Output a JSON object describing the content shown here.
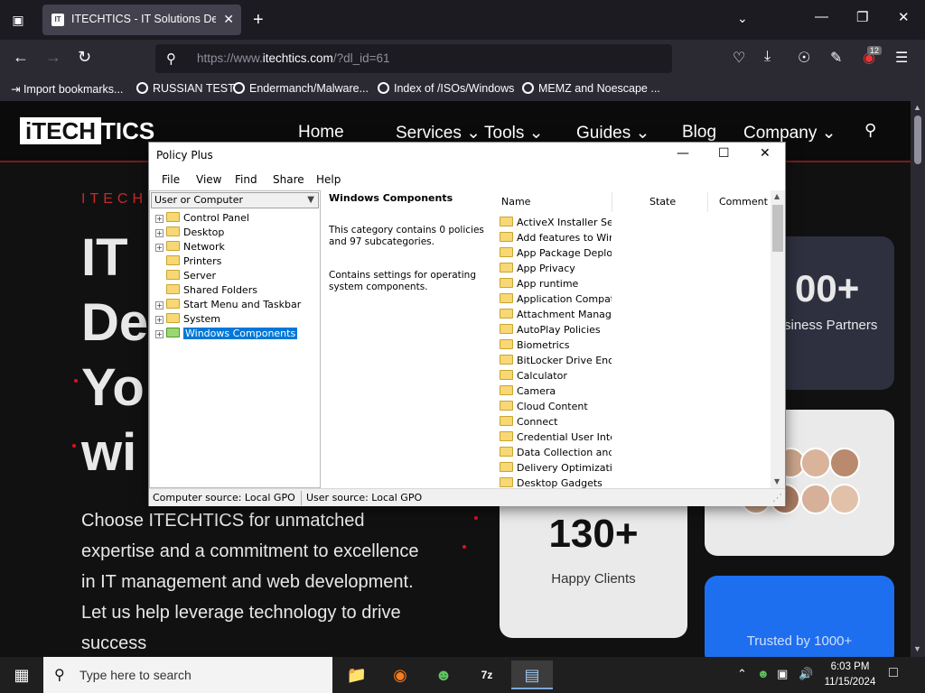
{
  "browser": {
    "tab_title": "ITECHTICS - IT Solutions Design",
    "url_prefix": "https://www.",
    "url_domain": "itechtics.com",
    "url_suffix": "/?dl_id=61",
    "extension_badge": "12",
    "bookmarks": [
      "Import bookmarks...",
      "RUSSIAN TEST",
      "Endermanch/Malware...",
      "Index of /ISOs/Windows",
      "MEMZ and Noescape ..."
    ]
  },
  "site": {
    "logo_box": "iTECH",
    "logo_rest": "TICS",
    "nav": [
      "Home",
      "Services",
      "Tools",
      "Guides",
      "Blog",
      "Company"
    ],
    "kicker": "ITECHT",
    "hero_lines": [
      "IT",
      "De",
      "Yo",
      "wi"
    ],
    "hero_sub": "Choose ITECHTICS for unmatched expertise and a commitment to excellence in IT management and web development. Let us help leverage technology to drive success",
    "partners_num": "00+",
    "partners_label": "siness Partners",
    "clients_num": "130+",
    "clients_label": "Happy Clients",
    "trusted_label": "Trusted by 1000+"
  },
  "policy_plus": {
    "title": "Policy Plus",
    "menu": [
      "File",
      "View",
      "Find",
      "Share",
      "Help"
    ],
    "combo_value": "User or Computer",
    "tree": [
      {
        "label": "Control Panel",
        "expandable": true
      },
      {
        "label": "Desktop",
        "expandable": true
      },
      {
        "label": "Network",
        "expandable": true
      },
      {
        "label": "Printers",
        "expandable": false
      },
      {
        "label": "Server",
        "expandable": false
      },
      {
        "label": "Shared Folders",
        "expandable": false
      },
      {
        "label": "Start Menu and Taskbar",
        "expandable": true
      },
      {
        "label": "System",
        "expandable": true
      },
      {
        "label": "Windows Components",
        "expandable": true,
        "selected": true
      }
    ],
    "detail_title": "Windows Components",
    "detail_text_1": "This category contains 0 policies and 97 subcategories.",
    "detail_text_2": "Contains settings for operating system components.",
    "columns": [
      "Name",
      "State",
      "Comment"
    ],
    "items": [
      "ActiveX Installer Ser...",
      "Add features to Win...",
      "App Package Deplo...",
      "App Privacy",
      "App runtime",
      "Application Compati...",
      "Attachment Manager",
      "AutoPlay Policies",
      "Biometrics",
      "BitLocker Drive Enc...",
      "Calculator",
      "Camera",
      "Cloud Content",
      "Connect",
      "Credential User Inter...",
      "Data Collection and ...",
      "Delivery Optimization",
      "Desktop Gadgets"
    ],
    "status_computer": "Computer source:  Local GPO",
    "status_user": "User source:  Local GPO"
  },
  "taskbar": {
    "search_placeholder": "Type here to search",
    "time": "6:03 PM",
    "date": "11/15/2024"
  }
}
